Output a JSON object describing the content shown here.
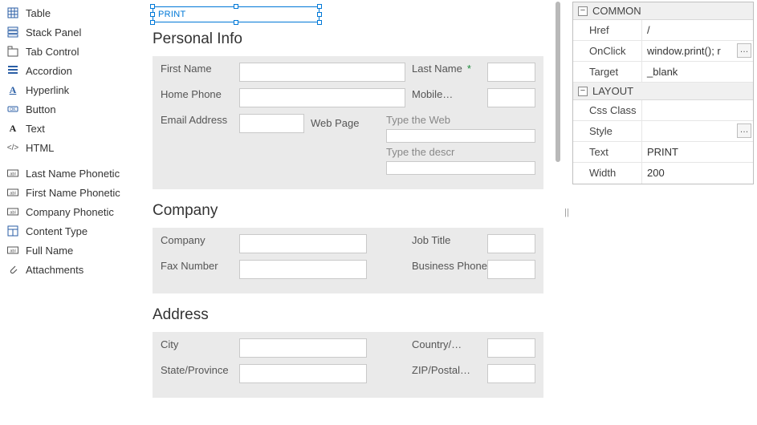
{
  "toolbox": {
    "items": [
      {
        "icon": "table",
        "label": "Table"
      },
      {
        "icon": "stack",
        "label": "Stack Panel"
      },
      {
        "icon": "tab",
        "label": "Tab Control"
      },
      {
        "icon": "accordion",
        "label": "Accordion"
      },
      {
        "icon": "hyperlink",
        "label": "Hyperlink"
      },
      {
        "icon": "button",
        "label": "Button"
      },
      {
        "icon": "text",
        "label": "Text"
      },
      {
        "icon": "html",
        "label": "HTML"
      }
    ],
    "fields": [
      {
        "label": "Last Name Phonetic"
      },
      {
        "label": "First Name Phonetic"
      },
      {
        "label": "Company Phonetic"
      },
      {
        "label": "Content Type",
        "icon": "content-type"
      },
      {
        "label": "Full Name"
      },
      {
        "label": "Attachments",
        "icon": "attach"
      }
    ]
  },
  "canvas": {
    "selected_text": "PRINT",
    "sections": {
      "personal": {
        "title": "Personal Info",
        "first_name": "First Name",
        "last_name": "Last Name",
        "home_phone": "Home Phone",
        "mobile": "Mobile…",
        "email": "Email Address",
        "web_page": "Web Page",
        "web_placeholder": "Type the Web",
        "web_desc_placeholder": "Type the descr"
      },
      "company": {
        "title": "Company",
        "company": "Company",
        "job_title": "Job Title",
        "fax": "Fax Number",
        "business_phone": "Business Phone"
      },
      "address": {
        "title": "Address",
        "city": "City",
        "country": "Country/…",
        "state": "State/Province",
        "zip": "ZIP/Postal…"
      }
    }
  },
  "propgrid": {
    "categories": [
      {
        "name": "COMMON",
        "rows": [
          {
            "name": "Href",
            "value": "/"
          },
          {
            "name": "OnClick",
            "value": "window.print(); r",
            "ellipsis": true
          },
          {
            "name": "Target",
            "value": "_blank"
          }
        ]
      },
      {
        "name": "LAYOUT",
        "rows": [
          {
            "name": "Css Class",
            "value": ""
          },
          {
            "name": "Style",
            "value": "",
            "ellipsis": true
          },
          {
            "name": "Text",
            "value": "PRINT"
          },
          {
            "name": "Width",
            "value": "200"
          }
        ]
      }
    ]
  }
}
